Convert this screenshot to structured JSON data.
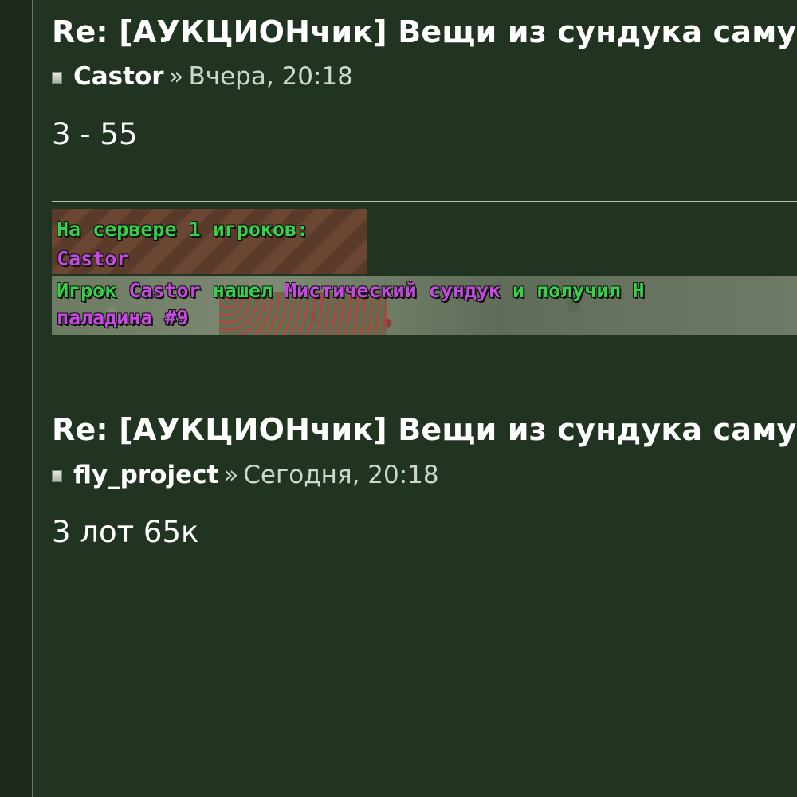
{
  "posts": [
    {
      "title": "Re: [АУКЦИОНчик] Вещи из сундука самур",
      "author": "Castor",
      "separator": "»",
      "date": "Вчера, 20:18",
      "body": "3 - 55"
    },
    {
      "title": "Re: [АУКЦИОНчик] Вещи из сундука самур",
      "author": "fly_project",
      "separator": "»",
      "date": "Сегодня, 20:18",
      "body": "3 лот 65к"
    }
  ],
  "game_screenshot": {
    "line1": "На сервере 1 игроков:",
    "line2": "Castor",
    "line3_part1": "Игрок",
    "line3_part2": "Castor",
    "line3_part3": "нашел",
    "line3_part4": "Мистический сундук",
    "line3_part5": "и получил Н",
    "line4": "паладина #9"
  },
  "colors": {
    "background": "#213321",
    "game_text_green": "#37d14a",
    "game_text_purple": "#c54ae0"
  }
}
